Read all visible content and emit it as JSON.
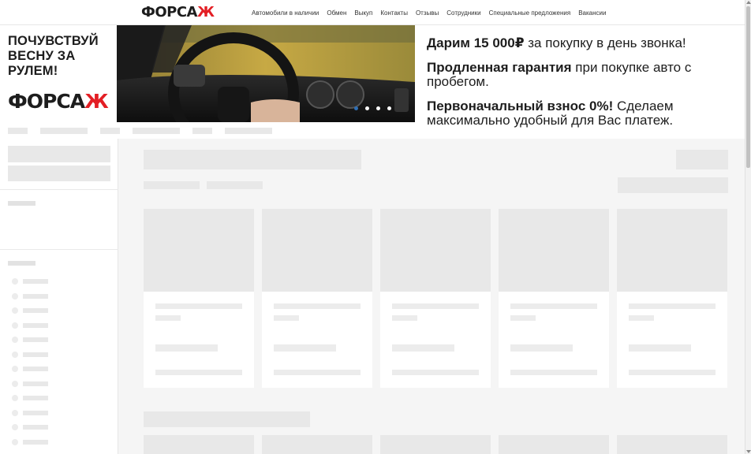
{
  "brand": {
    "logo_text_main": "ФОРСА",
    "logo_text_accent": "Ж",
    "accent_color": "#e31e24",
    "text_color": "#1d1d1d"
  },
  "nav": {
    "items": [
      {
        "label": "Автомобили в наличии"
      },
      {
        "label": "Обмен"
      },
      {
        "label": "Выкуп"
      },
      {
        "label": "Контакты"
      },
      {
        "label": "Отзывы"
      },
      {
        "label": "Сотрудники"
      },
      {
        "label": "Специальные предложения"
      },
      {
        "label": "Вакансии"
      }
    ]
  },
  "promo": {
    "slogan": "ПОЧУВСТВУЙ ВЕСНУ ЗА РУЛЕМ!",
    "offers": [
      {
        "bold": "Дарим 15 000₽",
        "text": " за покупку в день звонка!"
      },
      {
        "bold": "Продленная гарантия",
        "text": " при покупке авто с пробегом."
      },
      {
        "bold": "Первоначальный взнос 0%!",
        "text": " Сделаем максимально удобный для Вас платеж."
      }
    ],
    "slides": 4,
    "active_slide": 1,
    "active_dot_color": "#2f6fb5"
  },
  "skeleton": {
    "placeholder_color": "#e8e8e8",
    "page_bg": "#f5f5f5",
    "card_count": 5
  },
  "icons": {
    "scroll_up": "chevron-up-icon",
    "scroll_down": "chevron-down-icon",
    "radio": "radio-icon"
  }
}
